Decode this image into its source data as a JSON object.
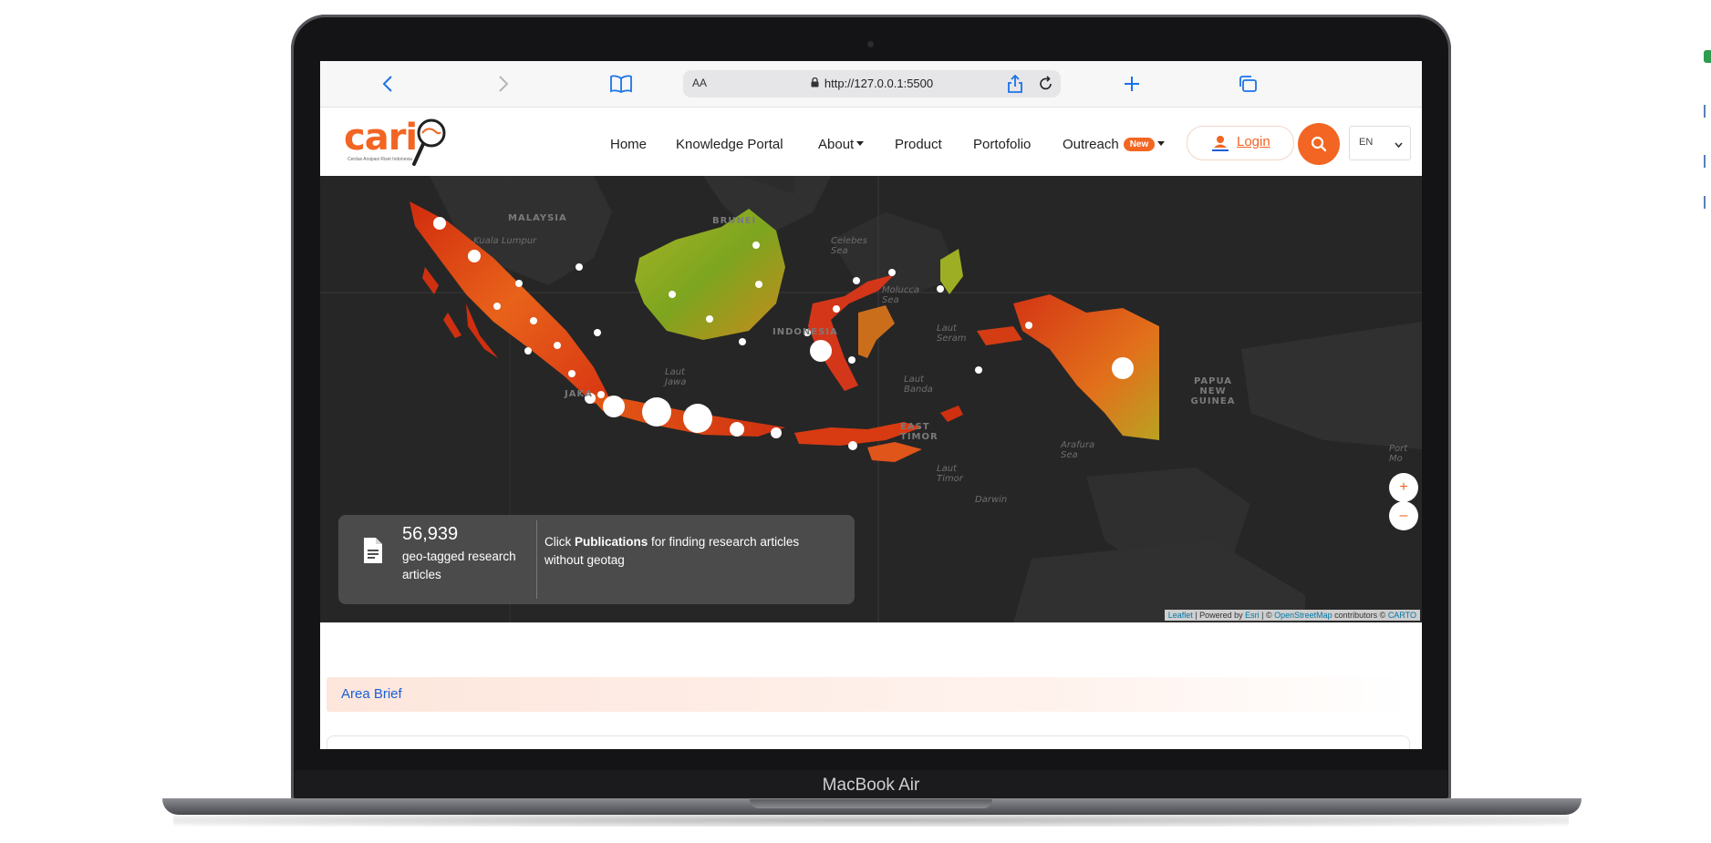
{
  "device": {
    "brand_label": "MacBook Air"
  },
  "browser": {
    "url": "http://127.0.0.1:5500",
    "reader_label": "AA",
    "icons": [
      "back-icon",
      "forward-icon",
      "bookmarks-icon",
      "lock-icon",
      "reload-icon",
      "share-icon",
      "new-tab-icon",
      "tabs-icon"
    ]
  },
  "site": {
    "logo_text": "cari",
    "logo_tagline": "Cerdas Arsipasi Riset Indonesia",
    "nav": [
      {
        "label": "Home"
      },
      {
        "label": "Knowledge Portal"
      },
      {
        "label": "About",
        "dropdown": true
      },
      {
        "label": "Product"
      },
      {
        "label": "Portofolio"
      },
      {
        "label": "Outreach",
        "badge": "New",
        "dropdown": true
      }
    ],
    "login_label": "Login",
    "language": "EN",
    "accent_color": "#f26522"
  },
  "map": {
    "labels": {
      "malaysia": "MALAYSIA",
      "brunei": "BRUNEI",
      "celebes_sea": "Celebes Sea",
      "molucca_sea": "Molucca Sea",
      "laut_jawa": "Laut Jawa",
      "laut_seram": "Laut Seram",
      "laut_banda": "Laut Banda",
      "arafura_sea": "Arafura Sea",
      "laut_timor": "Laut Timor",
      "east_timor": "EAST TIMOR",
      "papua_new_guinea": "PAPUA NEW GUINEA",
      "darwin": "Darwin",
      "port_moresby": "Port Mo",
      "jakarta": "JAKA",
      "kuala_lumpur": "Kuala Lumpur",
      "indonesia": "INDONESIA"
    },
    "stats": {
      "count": "56,939",
      "description": "geo-tagged research articles",
      "note_prefix": "Click ",
      "note_bold": "Publications",
      "note_suffix": " for finding research articles without geotag"
    },
    "zoom_in": "+",
    "zoom_out": "–",
    "attribution": {
      "leaflet": "Leaflet",
      "powered": " | Powered by ",
      "esri": "Esri",
      "osm_prefix": " | © ",
      "osm": "OpenStreetMap",
      "contributors": " contributors © ",
      "carto": "CARTO"
    }
  },
  "area_brief_label": "Area Brief"
}
